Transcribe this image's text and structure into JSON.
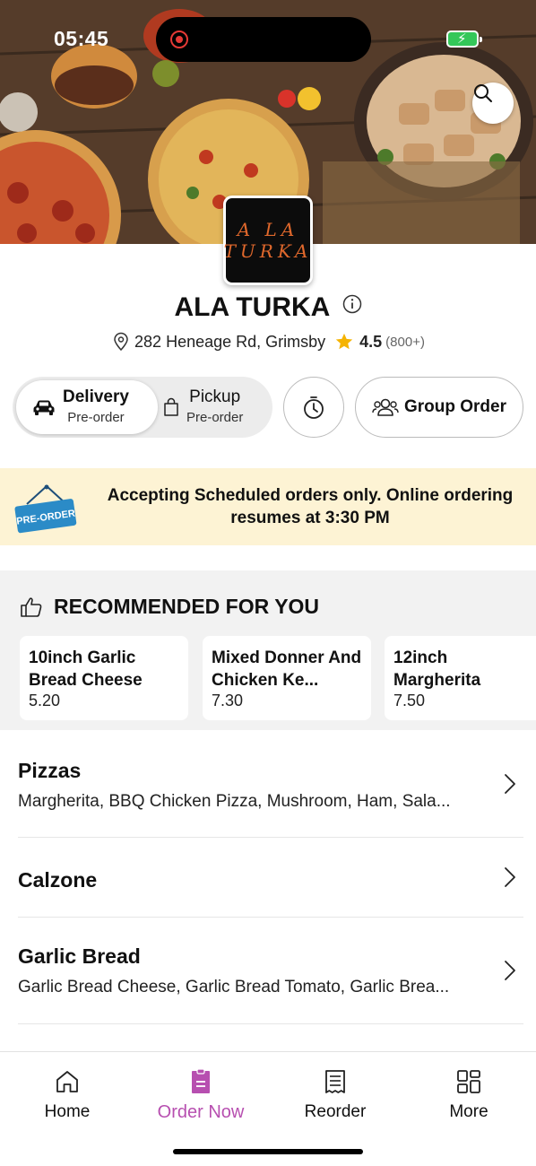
{
  "status": {
    "time": "05:45"
  },
  "restaurant": {
    "logo_line1": "A LA",
    "logo_line2": "TURKA",
    "name": "ALA TURKA",
    "address": "282 Heneage Rd, Grimsby",
    "rating": "4.5",
    "rating_count": "(800+)"
  },
  "order_mode": {
    "delivery": {
      "label": "Delivery",
      "sub": "Pre-order"
    },
    "pickup": {
      "label": "Pickup",
      "sub": "Pre-order"
    },
    "group_order_label": "Group Order"
  },
  "banner": {
    "sign_text": "PRE-ORDER",
    "message": "Accepting Scheduled orders only. Online ordering resumes at 3:30 PM"
  },
  "recommended": {
    "title": "RECOMMENDED FOR YOU",
    "items": [
      {
        "name": "10inch Garlic Bread Cheese",
        "price": "5.20"
      },
      {
        "name": "Mixed Donner And Chicken Ke...",
        "price": "7.30"
      },
      {
        "name": "12inch Margherita",
        "price": "7.50"
      }
    ]
  },
  "categories": [
    {
      "name": "Pizzas",
      "desc": "Margherita, BBQ Chicken Pizza, Mushroom, Ham, Sala..."
    },
    {
      "name": "Calzone",
      "desc": ""
    },
    {
      "name": "Garlic Bread",
      "desc": "Garlic Bread Cheese, Garlic Bread Tomato, Garlic Brea..."
    }
  ],
  "tabs": [
    {
      "label": "Home",
      "icon": "home-icon"
    },
    {
      "label": "Order Now",
      "icon": "order-icon"
    },
    {
      "label": "Reorder",
      "icon": "receipt-icon"
    },
    {
      "label": "More",
      "icon": "grid-icon"
    }
  ],
  "colors": {
    "accent": "#b74fb0",
    "banner_bg": "#fdf3d4",
    "star": "#f5b301"
  }
}
